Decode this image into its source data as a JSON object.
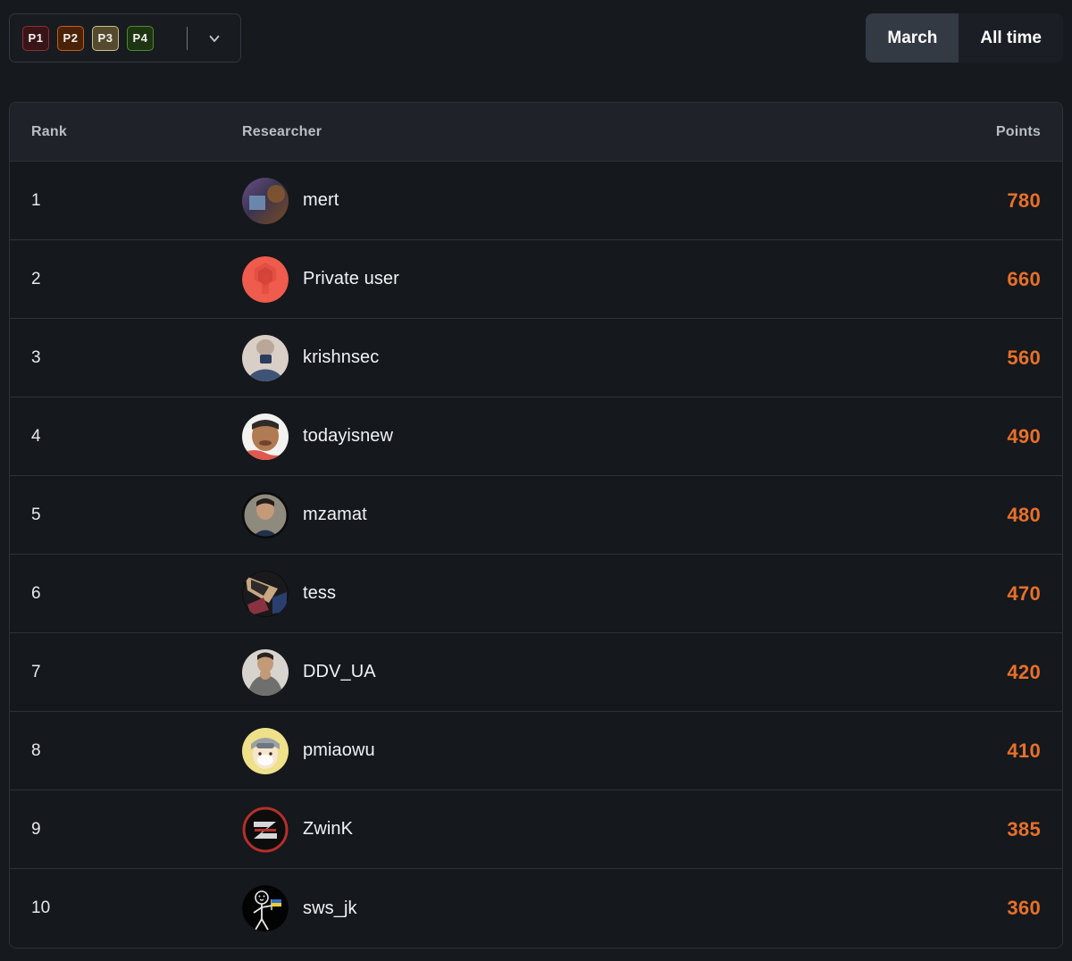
{
  "colors": {
    "page_bg": "#16191e",
    "table_bg": "#15181c",
    "header_bg": "#1f2329",
    "border": "#2e3338",
    "points_accent": "#e8702a",
    "toggle_active_bg": "#343a43"
  },
  "filters": {
    "severity_label": "severity-filter",
    "severities": [
      {
        "label": "P1",
        "name": "severity-badge-p1",
        "bg": "#3a1518",
        "border": "#8d2f33"
      },
      {
        "label": "P2",
        "name": "severity-badge-p2",
        "bg": "#4a2208",
        "border": "#c15f1c"
      },
      {
        "label": "P3",
        "name": "severity-badge-p3",
        "bg": "#554a2e",
        "border": "#ccc08a"
      },
      {
        "label": "P4",
        "name": "severity-badge-p4",
        "bg": "#1d3512",
        "border": "#4e8c2c"
      }
    ],
    "dropdown_icon": "chevron-down-icon"
  },
  "range_toggle": {
    "options": [
      {
        "label": "March",
        "selected": true
      },
      {
        "label": "All time",
        "selected": false
      }
    ]
  },
  "table": {
    "columns": {
      "rank": "Rank",
      "researcher": "Researcher",
      "points": "Points"
    },
    "rows": [
      {
        "rank": "1",
        "researcher": "mert",
        "points": "780",
        "avatar": "photo-purple"
      },
      {
        "rank": "2",
        "researcher": "Private user",
        "points": "660",
        "avatar": "private-user-logo"
      },
      {
        "rank": "3",
        "researcher": "krishnsec",
        "points": "560",
        "avatar": "photo-light"
      },
      {
        "rank": "4",
        "researcher": "todayisnew",
        "points": "490",
        "avatar": "photo-face"
      },
      {
        "rank": "5",
        "researcher": "mzamat",
        "points": "480",
        "avatar": "photo-dark-ring"
      },
      {
        "rank": "6",
        "researcher": "tess",
        "points": "470",
        "avatar": "anime-dark"
      },
      {
        "rank": "7",
        "researcher": "DDV_UA",
        "points": "420",
        "avatar": "photo-grey"
      },
      {
        "rank": "8",
        "researcher": "pmiaowu",
        "points": "410",
        "avatar": "anime-yellow"
      },
      {
        "rank": "9",
        "researcher": "ZwinK",
        "points": "385",
        "avatar": "z-logo-red"
      },
      {
        "rank": "10",
        "researcher": "sws_jk",
        "points": "360",
        "avatar": "stickman-flag"
      }
    ]
  }
}
